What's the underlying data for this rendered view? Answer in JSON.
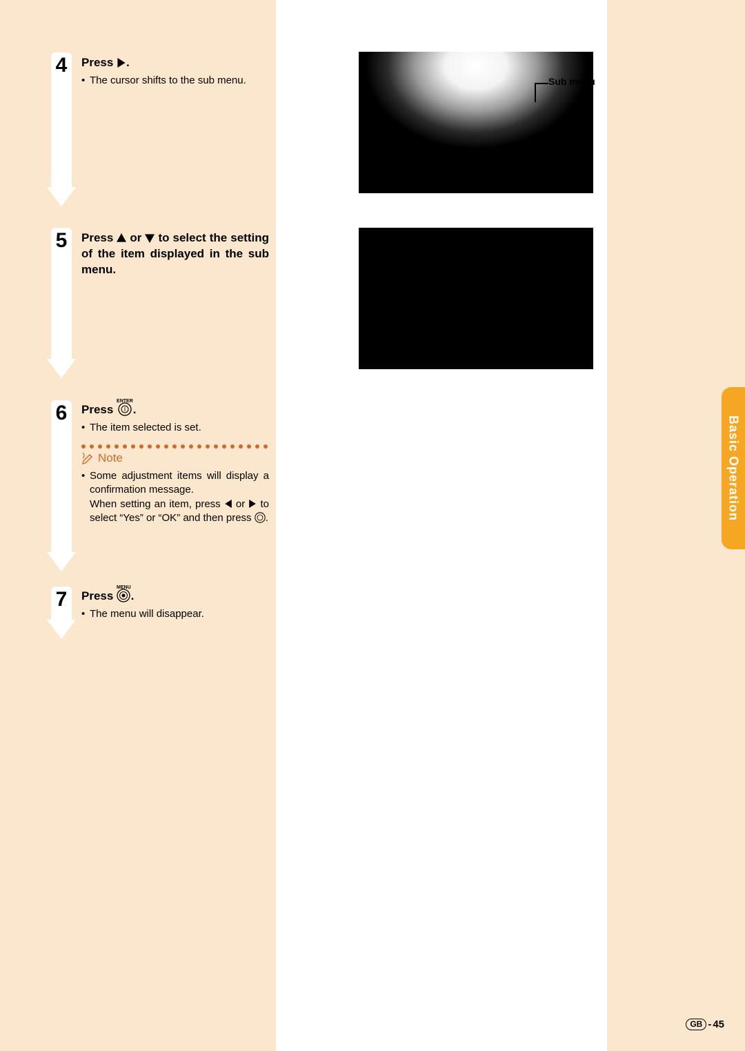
{
  "side_tab": "Basic Operation",
  "submenu_callout": "Sub menu",
  "steps": {
    "s4": {
      "num": "4",
      "title_a": "Press ",
      "title_b": ".",
      "bullet": "The cursor shifts to the sub menu."
    },
    "s5": {
      "num": "5",
      "title_a": "Press ",
      "title_b": " or ",
      "title_c": " to select the set­ting of the item displayed in the sub menu."
    },
    "s6": {
      "num": "6",
      "icon_label": "ENTER",
      "title_a": "Press ",
      "title_b": ".",
      "bullet": "The item selected is set.",
      "note_label": "Note",
      "note_a": "Some adjustment items will display a confirmation message.",
      "note_b": "When setting an item, press ",
      "note_c": " or ",
      "note_d": " to select “Yes” or “OK” and then press ",
      "note_e": "."
    },
    "s7": {
      "num": "7",
      "icon_label": "MENU",
      "title_a": "Press ",
      "title_b": ".",
      "bullet": "The menu will disappear."
    }
  },
  "page": {
    "region": "GB",
    "sep": "-",
    "num": "45"
  }
}
